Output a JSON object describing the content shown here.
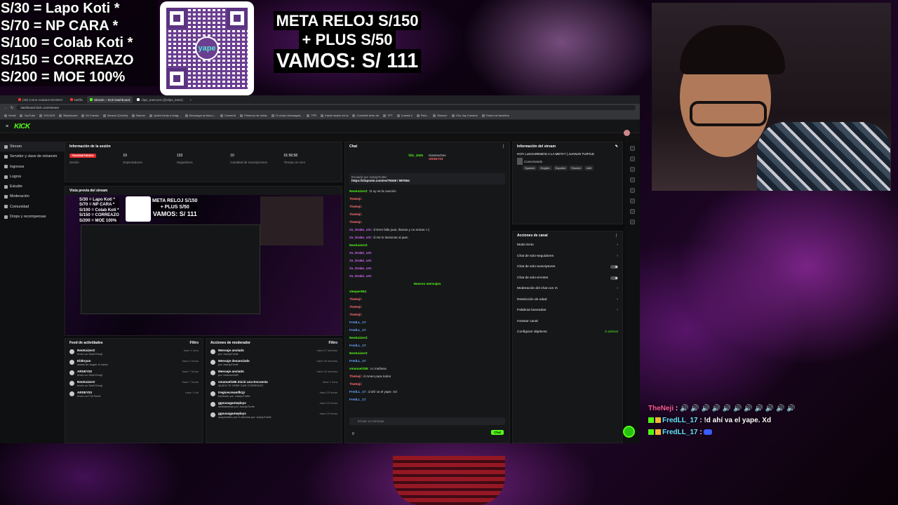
{
  "overlay": {
    "tiers": [
      "S/30 = Lapo Koti *",
      "S/70 =  NP CARA *",
      "S/100 = Colab Koti *",
      "S/150 = CORREAZO",
      "S/200 = MOE 100%"
    ],
    "qr_brand": "yape",
    "goal_line1": "META RELOJ S/150",
    "goal_line2": "+ PLUS S/50",
    "goal_line3": "VAMOS: S/ 111",
    "chat": [
      {
        "user": "TheNeji",
        "message": "🔊 🔊 🔊 🔊 🔊 🔊 🔊 🔊 🔊 🔊 🔊"
      },
      {
        "user": "FredLL_17",
        "message": "!d ahí va el yape. Xd"
      },
      {
        "user": "FredLL_17",
        "message": ""
      }
    ]
  },
  "browser": {
    "tabs": [
      "(49) Como roubarei MASRA!",
      "Netflix",
      "Stream – Kick Dashboard",
      "clips_team123 (@clips_team)",
      "+"
    ],
    "url": "dashboard.kick.com/stream",
    "bookmarks": [
      "Gmail",
      "YouTube",
      "SOCIAIS",
      "Blackboard",
      "Mi Cuenta",
      "Verano! (Cicelio)",
      "Banner",
      "Quitar fondo a imag...",
      "Descargar archivo (...",
      "Convertir",
      "Primeros de notas",
      "Tu mejor descargad...",
      "TPR",
      "Iniciar sesión en la",
      "Convertir texto de",
      "TPT",
      "Cuenta 2",
      "Relo...",
      "Disney+",
      "Chu Jay Cuentos",
      "Todos los favoritos"
    ]
  },
  "kick": {
    "logo": "KICK",
    "sidebar": [
      "Stream",
      "Servidor y clave de retransm",
      "Ingresos",
      "Logros",
      "Estudio",
      "Moderación",
      "Comunidad",
      "Drops y recompensas"
    ],
    "session": {
      "title": "Información de la sesión",
      "status": "TRANSMITIENDO",
      "status_label": "Sesión",
      "viewers": "10",
      "viewers_label": "Espectadores",
      "followers": "133",
      "followers_label": "Seguidores",
      "subs": "10",
      "subs_label": "Cantidad de suscripciones",
      "live_time": "01:56:58",
      "live_time_label": "Tiempo en vivo"
    },
    "preview_title": "Vista previa del stream",
    "activity": {
      "title": "Feed de actividades",
      "filter": "Filtro",
      "items": [
        {
          "name": "NeoKaizerZ",
          "sub": "envió un Skull Emoji",
          "time": "hace 1 hora"
        },
        {
          "name": "El3bryan",
          "sub": "acaba de seguir el canal",
          "time": "hace 2 horas"
        },
        {
          "name": "ARSEY03",
          "sub": "envió un Skull Emoji",
          "time": "hace 7 horas"
        },
        {
          "name": "NeoKaizerZ",
          "sub": "envió un Skull Emoji",
          "time": "hace 7 horas"
        },
        {
          "name": "ARSEY03",
          "sub": "envió un Full Send",
          "time": "hace 1 día"
        }
      ]
    },
    "modactions": {
      "title": "Acciones de moderador",
      "filter": "Filtro",
      "items": [
        {
          "name": "Mensaje anclado",
          "sub": "por JuanjoTurtle",
          "time": "hace 27 minutos"
        },
        {
          "name": "Mensaje desanclado",
          "sub": "por JuanjoTurtle",
          "time": "hace 28 minutos"
        },
        {
          "name": "Mensaje anclado",
          "sub": "por vmanuel185",
          "time": "hace 32 minutos"
        },
        {
          "name": "vmanuel185 inició una Encuesta",
          "sub": "QUIEN TE DEBE DAR CORREAZO",
          "time": "hace 1 hora"
        },
        {
          "name": "tregicecreamfk1jr",
          "sub": "baneado por JuanjoTurtle",
          "time": "hace 23 horas"
        },
        {
          "name": "ggsusagameplays",
          "sub": "desbaneado por JuanjoTurtle",
          "time": "hace 23 horas"
        },
        {
          "name": "ggsusagameplays",
          "sub": "suspendido por 5 minutos por JuanjoTurtle",
          "time": "hace 23 horas"
        }
      ]
    },
    "chat": {
      "title": "Chat",
      "top": [
        "fdic_2025",
        "GianNoches",
        "ARSEY03"
      ],
      "pinned_by": "Enviado por JuanjoTurtle",
      "pinned_link": "https://xloposte.com/es/75049 / 987654",
      "new_label": "Nuevos mensajes",
      "input_placeholder": "Enviar un mensaje",
      "send": "Chat",
      "count": "0",
      "lines": [
        {
          "u": "NeoKaizerZ",
          "c": "g",
          "m": ":D uy es la canción"
        },
        {
          "u": "TheNeji",
          "c": "r",
          "m": ""
        },
        {
          "u": "TheNeji",
          "c": "r",
          "m": ""
        },
        {
          "u": "TheNeji",
          "c": "r",
          "m": ""
        },
        {
          "u": "TheNeji",
          "c": "r",
          "m": ""
        },
        {
          "u": "Xx_Drako_xXI",
          "c": "p",
          "m": ":d Eres falla juan, llamas y no entras >:("
        },
        {
          "u": "Xx_Drako_xXI",
          "c": "p",
          "m": ":d me lo ilusionas al jaan"
        },
        {
          "u": "NeoKaizerZ",
          "c": "g",
          "m": ""
        },
        {
          "u": "Xx_Drako_xXI",
          "c": "p",
          "m": ""
        },
        {
          "u": "Xx_Drako_xXI",
          "c": "p",
          "m": ""
        },
        {
          "u": "Xx_Drako_xXI",
          "c": "p",
          "m": ""
        },
        {
          "u": "Xx_Drako_xXI",
          "c": "p",
          "m": ""
        },
        {
          "u": "sleeper993",
          "c": "g",
          "m": ""
        },
        {
          "u": "TheNeji",
          "c": "r",
          "m": ""
        },
        {
          "u": "TheNeji",
          "c": "r",
          "m": ""
        },
        {
          "u": "TheNeji",
          "c": "r",
          "m": ""
        },
        {
          "u": "FredLL_17",
          "c": "b",
          "m": ""
        },
        {
          "u": "FredLL_17",
          "c": "b",
          "m": ""
        },
        {
          "u": "NeoKaizerZ",
          "c": "g",
          "m": ""
        },
        {
          "u": "FredLL_17",
          "c": "b",
          "m": ""
        },
        {
          "u": "NeoKaizerZ",
          "c": "g",
          "m": ""
        },
        {
          "u": "FredLL_17",
          "c": "b",
          "m": ""
        },
        {
          "u": "vmanuel185",
          "c": "g",
          "m": ":cc mañana"
        },
        {
          "u": "TheNeji",
          "c": "r",
          "m": ":d Amen para todos"
        },
        {
          "u": "TheNeji",
          "c": "r",
          "m": ""
        },
        {
          "u": "FredLL_17",
          "c": "b",
          "m": ":d ahí va el yape. Xd"
        },
        {
          "u": "FredLL_17",
          "c": "b",
          "m": ""
        }
      ]
    },
    "streaminfo": {
      "title": "Información del stream",
      "stream_title": "HOY LLEGAREMOS A LA META? | JUANJO TURTLE",
      "category": "Conversando",
      "tags": [
        "Spanish",
        "English",
        "Español",
        "Shooter",
        "chill"
      ]
    },
    "channel_actions": {
      "title": "Acciones de canal",
      "rows": [
        "Modo lento",
        "Chat de solo-seguidores",
        "Chat de solo-suscriptores",
        "Chat de solo-emotes",
        "Moderación del chat con IA",
        "Restricción de edad",
        "Palabras baneadas",
        "Hostear canal",
        "Configurar objetivos"
      ],
      "goals_active": "2 activos"
    }
  }
}
